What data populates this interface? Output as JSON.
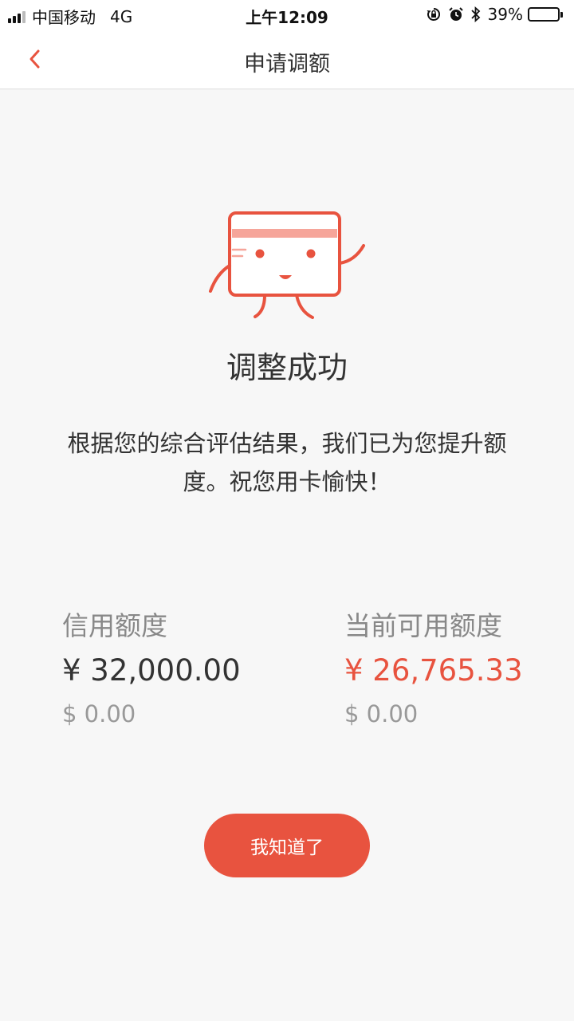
{
  "status_bar": {
    "carrier": "中国移动",
    "network": "4G",
    "time": "上午12:09",
    "battery_percent": "39%",
    "battery_level": 0.39,
    "icons": [
      "signal-icon",
      "rotation-lock-icon",
      "alarm-icon",
      "bluetooth-icon",
      "battery-icon"
    ]
  },
  "nav": {
    "title": "申请调额",
    "back_icon": "chevron-left-icon"
  },
  "result": {
    "title": "调整成功",
    "message": "根据您的综合评估结果，我们已为您提升额度。祝您用卡愉快！"
  },
  "amounts": {
    "credit_limit": {
      "label": "信用额度",
      "cny": "¥ 32,000.00",
      "usd": "$ 0.00"
    },
    "available": {
      "label": "当前可用额度",
      "cny": "¥ 26,765.33",
      "usd": "$ 0.00"
    }
  },
  "button": {
    "confirm_label": "我知道了"
  },
  "colors": {
    "accent": "#e8533f",
    "mascot_stripe": "#f6a59a",
    "background": "#f7f7f7"
  }
}
